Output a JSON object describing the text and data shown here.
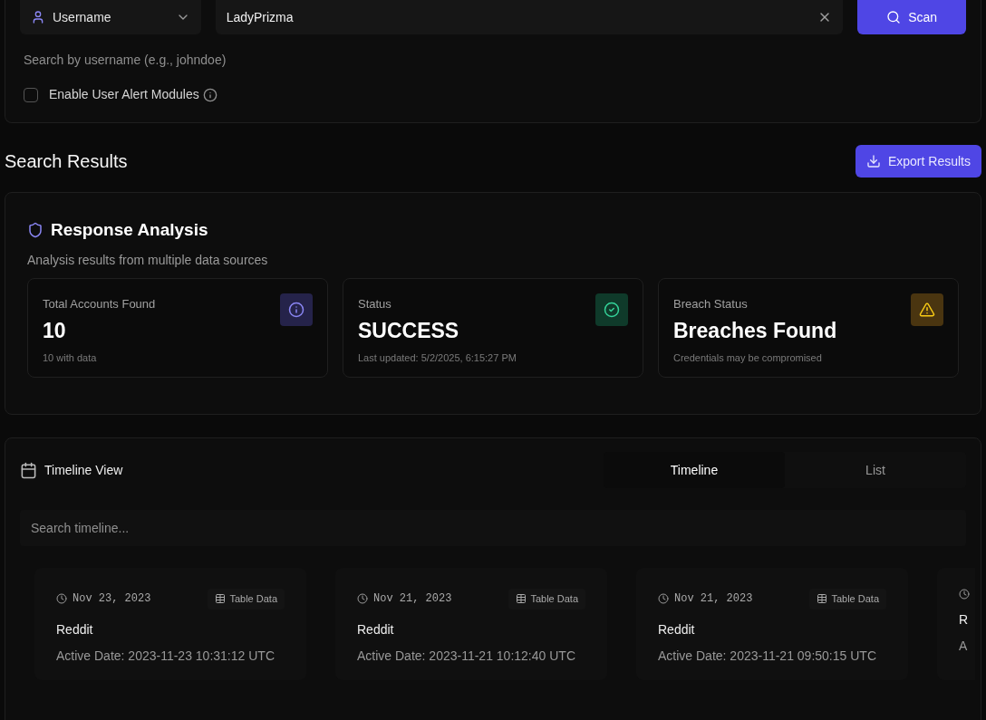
{
  "search": {
    "type_select": "Username",
    "query": "LadyPrizma",
    "scan_button": "Scan",
    "hint": "Search by username (e.g., johndoe)",
    "alert_modules": {
      "label": "Enable User Alert Modules",
      "checked": false
    }
  },
  "results": {
    "title": "Search Results",
    "export_button": "Export Results"
  },
  "analysis": {
    "title": "Response Analysis",
    "subtitle": "Analysis results from multiple data sources",
    "stats": [
      {
        "kind": "info",
        "label": "Total Accounts Found",
        "value": "10",
        "note": "10 with data"
      },
      {
        "kind": "success",
        "label": "Status",
        "value": "SUCCESS",
        "note": "Last updated: 5/2/2025, 6:15:27 PM"
      },
      {
        "kind": "warning",
        "label": "Breach Status",
        "value": "Breaches Found",
        "note": "Credentials may be compromised"
      }
    ]
  },
  "timeline": {
    "title": "Timeline View",
    "tabs": [
      {
        "label": "Timeline",
        "selected": true
      },
      {
        "label": "List",
        "selected": false
      }
    ],
    "search": {
      "placeholder": "Search timeline..."
    },
    "entries": [
      {
        "date": "Nov 23, 2023",
        "tag": "Table Data",
        "site": "Reddit",
        "detail": "Active Date: 2023-11-23 10:31:12 UTC"
      },
      {
        "date": "Nov 21, 2023",
        "tag": "Table Data",
        "site": "Reddit",
        "detail": "Active Date: 2023-11-21 10:12:40 UTC"
      },
      {
        "date": "Nov 21, 2023",
        "tag": "Table Data",
        "site": "Reddit",
        "detail": "Active Date: 2023-11-21 09:50:15 UTC"
      },
      {
        "site": "R",
        "detail": "A"
      }
    ]
  }
}
